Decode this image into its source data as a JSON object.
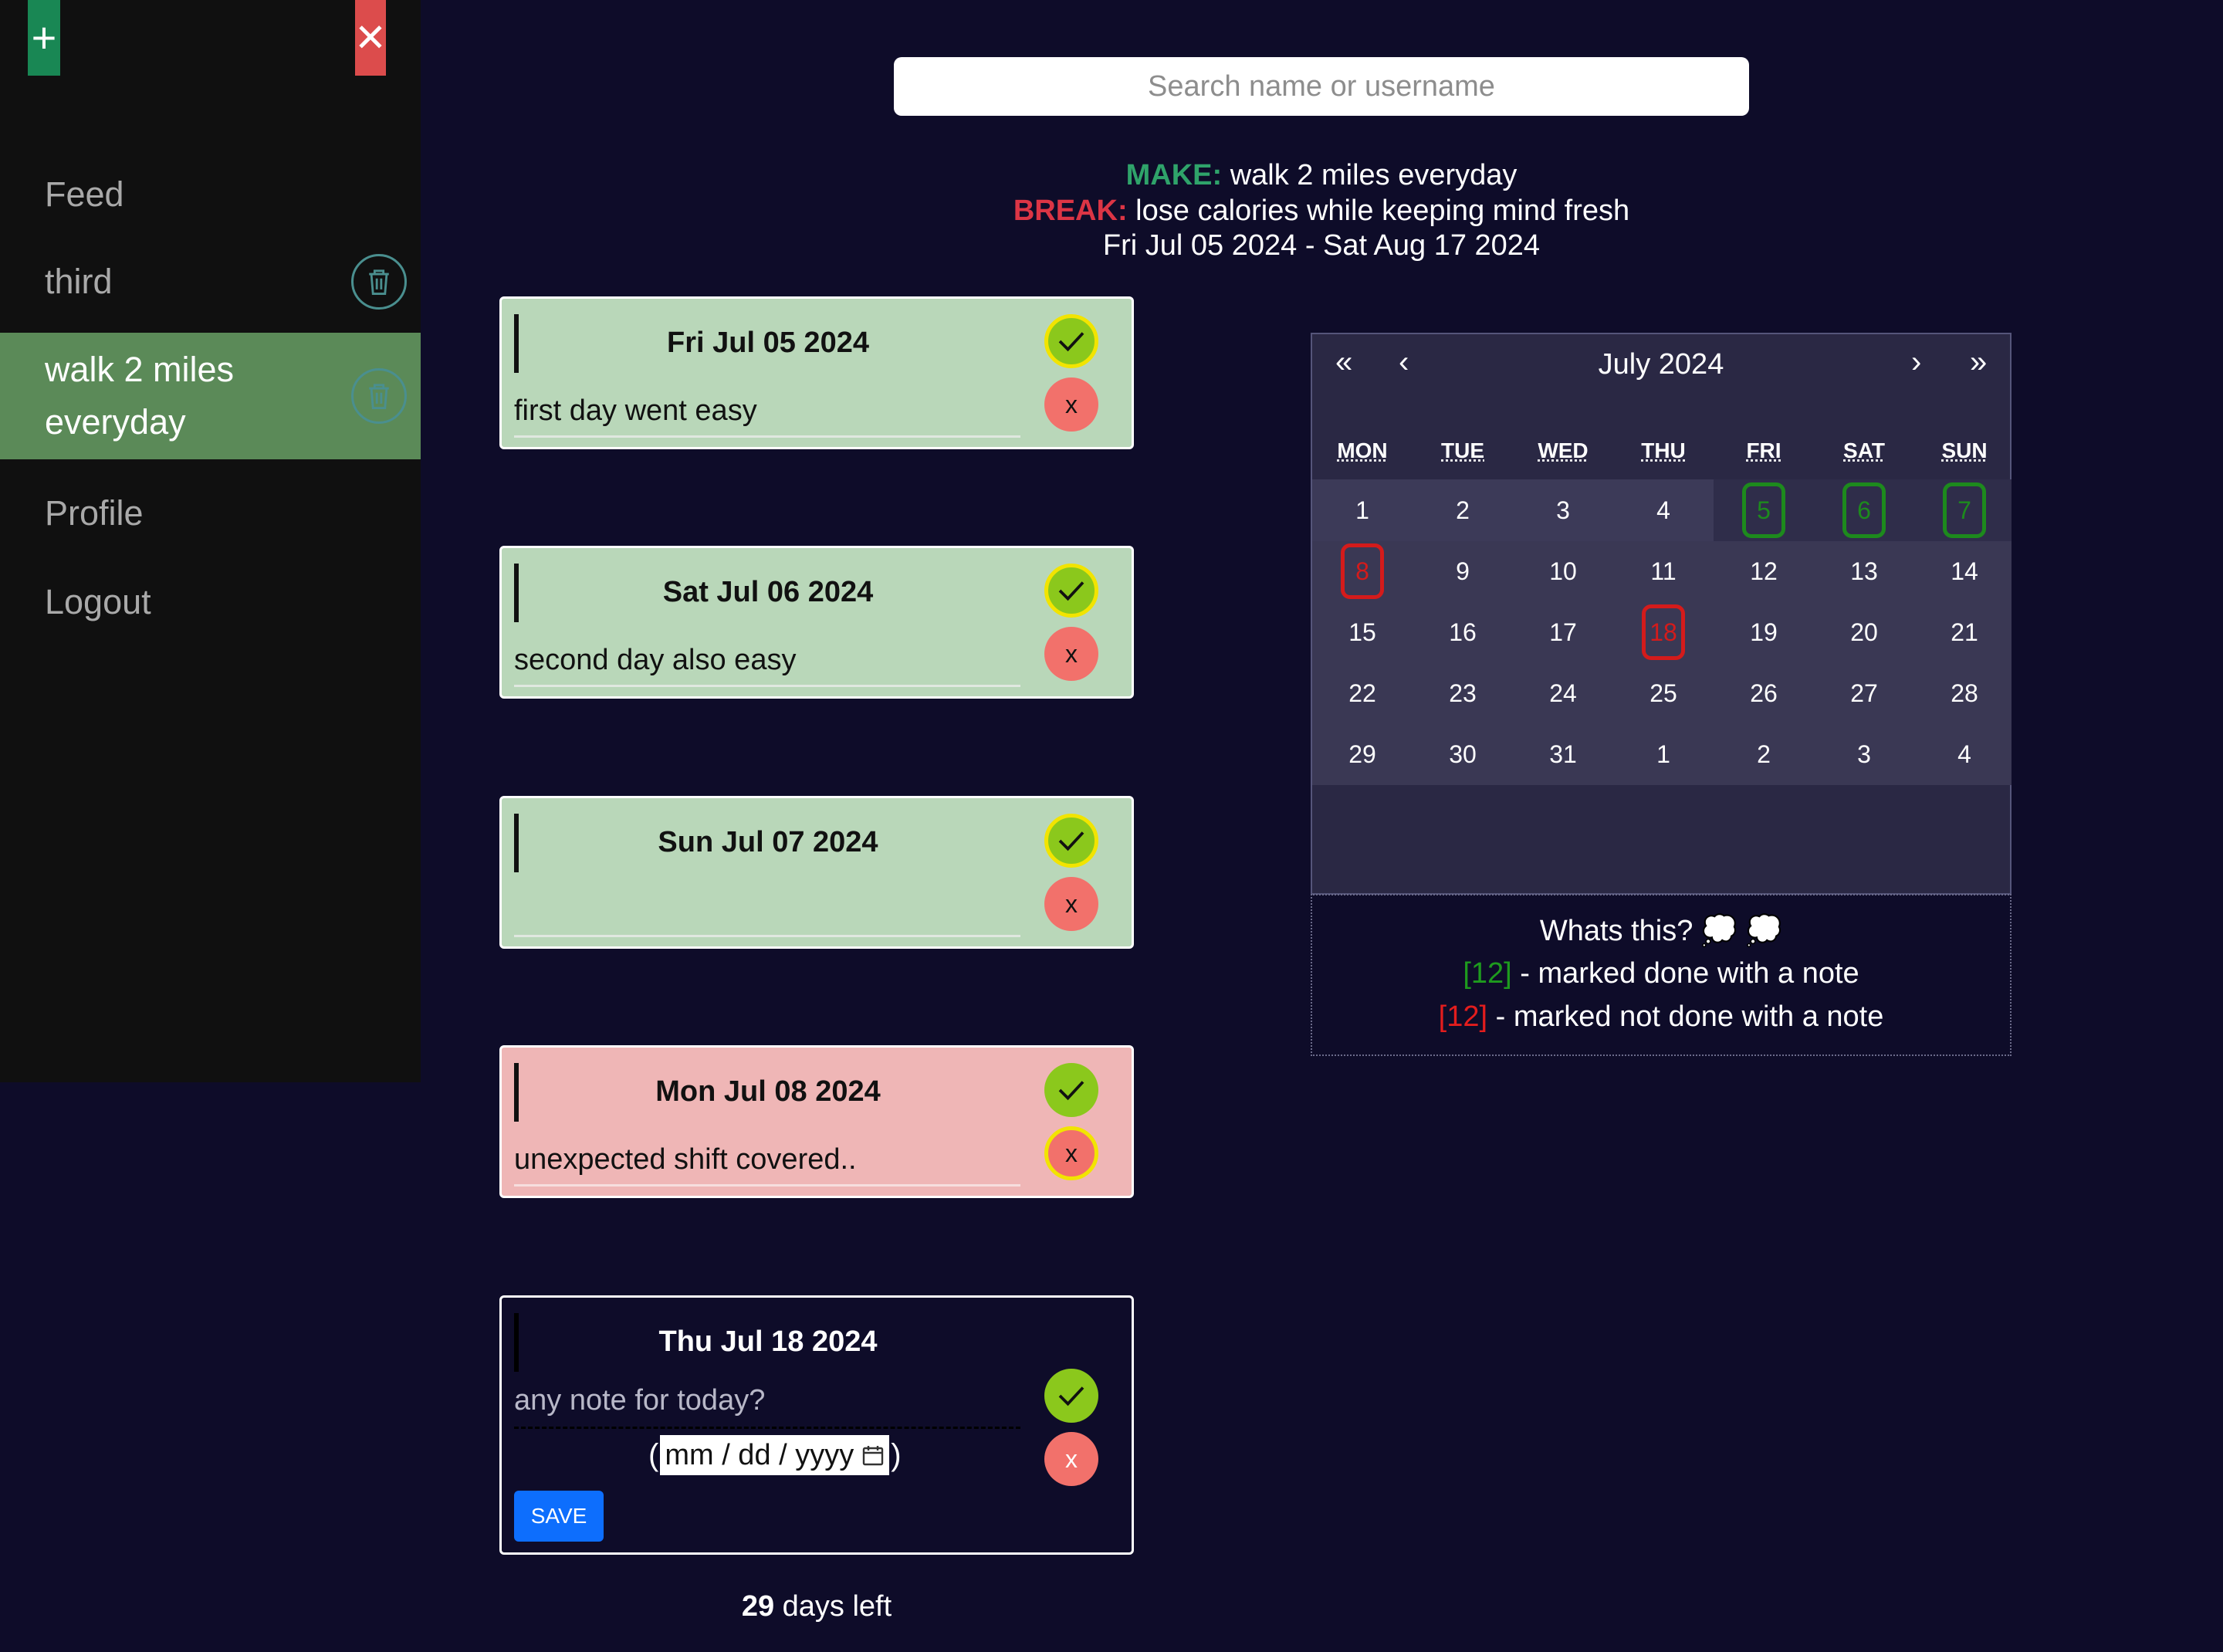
{
  "sidebar": {
    "add_label": "+",
    "close_label": "✕",
    "items": [
      {
        "label": "Feed"
      },
      {
        "label": "third"
      },
      {
        "label": "walk 2 miles everyday"
      },
      {
        "label": "Profile"
      },
      {
        "label": "Logout"
      }
    ]
  },
  "search": {
    "placeholder": "Search name or username"
  },
  "goal": {
    "make_label": "MAKE:",
    "make_text": "walk 2 miles everyday",
    "break_label": "BREAK:",
    "break_text": "lose calories while keeping mind fresh",
    "range": "Fri Jul 05 2024 - Sat Aug 17 2024"
  },
  "cards": [
    {
      "date": "Fri Jul 05 2024",
      "note": "first day went easy",
      "status": "done"
    },
    {
      "date": "Sat Jul 06 2024",
      "note": "second day also easy",
      "status": "done"
    },
    {
      "date": "Sun Jul 07 2024",
      "note": "",
      "status": "done"
    },
    {
      "date": "Mon Jul 08 2024",
      "note": "unexpected shift covered..",
      "status": "not-done"
    }
  ],
  "today": {
    "date": "Thu Jul 18 2024",
    "note_placeholder": "any note for today?",
    "paren_open": "(",
    "paren_close": ")",
    "date_placeholder": "mm / dd / yyyy",
    "save_label": "SAVE",
    "done_label": "✓",
    "not_done_label": "x"
  },
  "days_left": {
    "count": "29",
    "label": "days left"
  },
  "calendar": {
    "title": "July 2024",
    "nav": {
      "first": "«",
      "prev": "‹",
      "next": "›",
      "last": "»"
    },
    "weekdays": [
      "MON",
      "TUE",
      "WED",
      "THU",
      "FRI",
      "SAT",
      "SUN"
    ],
    "weeks": [
      [
        "1",
        "2",
        "3",
        "4",
        "5",
        "6",
        "7"
      ],
      [
        "8",
        "9",
        "10",
        "11",
        "12",
        "13",
        "14"
      ],
      [
        "15",
        "16",
        "17",
        "18",
        "19",
        "20",
        "21"
      ],
      [
        "22",
        "23",
        "24",
        "25",
        "26",
        "27",
        "28"
      ],
      [
        "29",
        "30",
        "31",
        "1",
        "2",
        "3",
        "4"
      ]
    ],
    "marked_done": [
      "5",
      "6",
      "7"
    ],
    "marked_not_done": [
      "8",
      "18"
    ]
  },
  "legend": {
    "title": "Whats this? 💭 💭",
    "done_sample": "[12]",
    "done_text": " - marked done with a note",
    "not_done_sample": "[12]",
    "not_done_text": " - marked not done with a note"
  },
  "colors": {
    "background": "#0e0c29",
    "done": "#1d8a1d",
    "not_done": "#d41b1b",
    "card_done": "#b9d7b9",
    "card_not_done": "#efb6b6",
    "save": "#0d6efd"
  }
}
